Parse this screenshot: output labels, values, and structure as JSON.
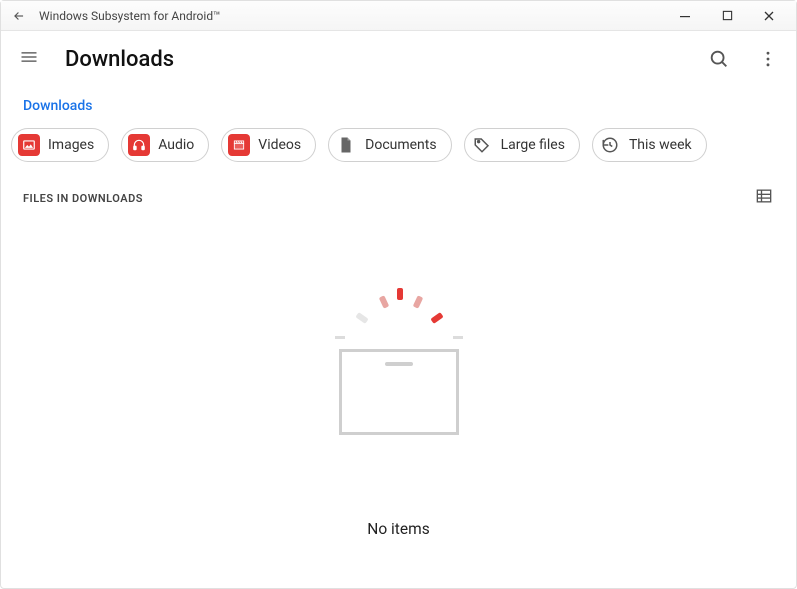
{
  "window": {
    "title": "Windows Subsystem for Android™"
  },
  "header": {
    "title": "Downloads"
  },
  "breadcrumb": {
    "label": "Downloads"
  },
  "chips": [
    {
      "label": "Images",
      "icon": "image-icon",
      "color": "red"
    },
    {
      "label": "Audio",
      "icon": "headphones-icon",
      "color": "red"
    },
    {
      "label": "Videos",
      "icon": "clapper-icon",
      "color": "red"
    },
    {
      "label": "Documents",
      "icon": "document-icon",
      "color": "gray"
    },
    {
      "label": "Large files",
      "icon": "tag-icon",
      "color": "plain"
    },
    {
      "label": "This week",
      "icon": "history-icon",
      "color": "plain"
    }
  ],
  "section": {
    "heading": "FILES IN DOWNLOADS"
  },
  "empty": {
    "message": "No items"
  }
}
